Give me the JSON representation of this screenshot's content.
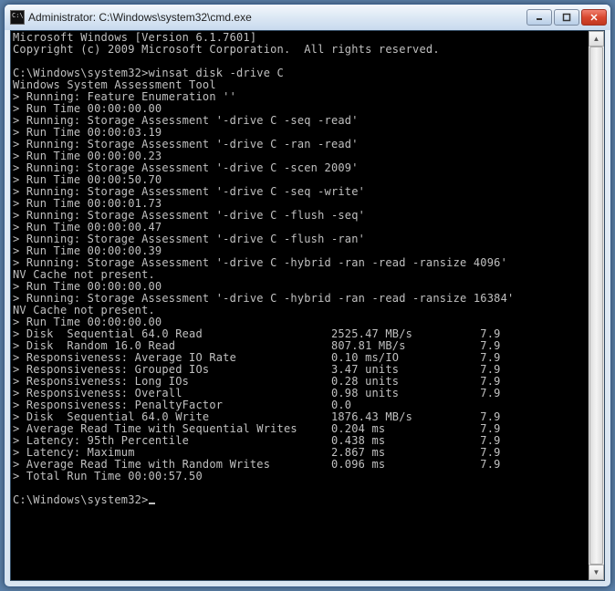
{
  "titlebar": {
    "title": "Administrator: C:\\Windows\\system32\\cmd.exe"
  },
  "terminal": {
    "header1": "Microsoft Windows [Version 6.1.7601]",
    "header2": "Copyright (c) 2009 Microsoft Corporation.  All rights reserved.",
    "prompt_path": "C:\\Windows\\system32>",
    "command": "winsat disk -drive C",
    "tool_name": "Windows System Assessment Tool",
    "lines": [
      "> Running: Feature Enumeration ''",
      "> Run Time 00:00:00.00",
      "> Running: Storage Assessment '-drive C -seq -read'",
      "> Run Time 00:00:03.19",
      "> Running: Storage Assessment '-drive C -ran -read'",
      "> Run Time 00:00:00.23",
      "> Running: Storage Assessment '-drive C -scen 2009'",
      "> Run Time 00:00:50.70",
      "> Running: Storage Assessment '-drive C -seq -write'",
      "> Run Time 00:00:01.73",
      "> Running: Storage Assessment '-drive C -flush -seq'",
      "> Run Time 00:00:00.47",
      "> Running: Storage Assessment '-drive C -flush -ran'",
      "> Run Time 00:00:00.39",
      "> Running: Storage Assessment '-drive C -hybrid -ran -read -ransize 4096'",
      "NV Cache not present.",
      "> Run Time 00:00:00.00",
      "> Running: Storage Assessment '-drive C -hybrid -ran -read -ransize 16384'",
      "NV Cache not present.",
      "> Run Time 00:00:00.00"
    ],
    "results": [
      {
        "label": "> Disk  Sequential 64.0 Read",
        "value": "2525.47 MB/s",
        "score": "7.9"
      },
      {
        "label": "> Disk  Random 16.0 Read",
        "value": "807.81 MB/s",
        "score": "7.9"
      },
      {
        "label": "> Responsiveness: Average IO Rate",
        "value": "0.10 ms/IO",
        "score": "7.9"
      },
      {
        "label": "> Responsiveness: Grouped IOs",
        "value": "3.47 units",
        "score": "7.9"
      },
      {
        "label": "> Responsiveness: Long IOs",
        "value": "0.28 units",
        "score": "7.9"
      },
      {
        "label": "> Responsiveness: Overall",
        "value": "0.98 units",
        "score": "7.9"
      },
      {
        "label": "> Responsiveness: PenaltyFactor",
        "value": "0.0",
        "score": ""
      },
      {
        "label": "> Disk  Sequential 64.0 Write",
        "value": "1876.43 MB/s",
        "score": "7.9"
      },
      {
        "label": "> Average Read Time with Sequential Writes",
        "value": "0.204 ms",
        "score": "7.9"
      },
      {
        "label": "> Latency: 95th Percentile",
        "value": "0.438 ms",
        "score": "7.9"
      },
      {
        "label": "> Latency: Maximum",
        "value": "2.867 ms",
        "score": "7.9"
      },
      {
        "label": "> Average Read Time with Random Writes",
        "value": "0.096 ms",
        "score": "7.9"
      }
    ],
    "total_line": "> Total Run Time 00:00:57.50",
    "final_prompt": "C:\\Windows\\system32>"
  }
}
